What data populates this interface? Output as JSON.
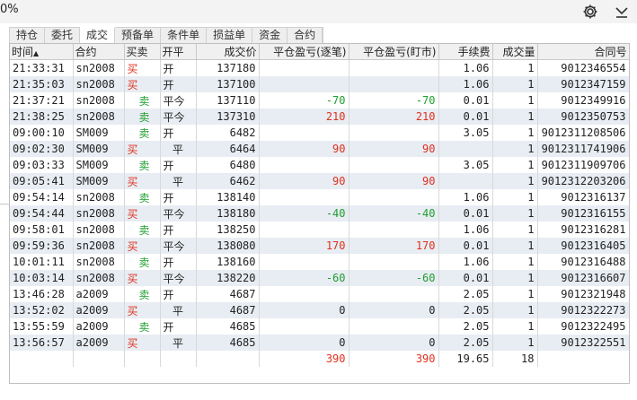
{
  "window": {
    "title": "0%"
  },
  "icons": {
    "settings": "gear-icon",
    "collapse": "chevron-down-icon"
  },
  "tabs": [
    {
      "label": "持仓",
      "active": false
    },
    {
      "label": "委托",
      "active": false
    },
    {
      "label": "成交",
      "active": true
    },
    {
      "label": "预备单",
      "active": false
    },
    {
      "label": "条件单",
      "active": false
    },
    {
      "label": "损益单",
      "active": false
    },
    {
      "label": "资金",
      "active": false
    },
    {
      "label": "合约",
      "active": false
    }
  ],
  "table": {
    "headers": {
      "time": "时间",
      "sort_mark": "▲",
      "code": "合约",
      "dir": "买卖",
      "oc": "开平",
      "price": "成交价",
      "pnl_trade": "平仓盈亏(逐笔)",
      "pnl_mark": "平仓盈亏(盯市)",
      "fee": "手续费",
      "qty": "成交量",
      "contract": "合同号"
    },
    "rows": [
      {
        "time": "21:33:31",
        "code": "sn2008",
        "dir": "买",
        "oc": "开",
        "price": "137180",
        "pnl_trade": "",
        "pnl_mark": "",
        "fee": "1.06",
        "qty": "1",
        "contract": "9012346554"
      },
      {
        "time": "21:35:03",
        "code": "sn2008",
        "dir": "买",
        "oc": "开",
        "price": "137100",
        "pnl_trade": "",
        "pnl_mark": "",
        "fee": "1.06",
        "qty": "1",
        "contract": "9012347159"
      },
      {
        "time": "21:37:21",
        "code": "sn2008",
        "dir": "卖",
        "oc": "平今",
        "price": "137110",
        "pnl_trade": "-70",
        "pnl_mark": "-70",
        "fee": "0.01",
        "qty": "1",
        "contract": "9012349916"
      },
      {
        "time": "21:38:25",
        "code": "sn2008",
        "dir": "卖",
        "oc": "平今",
        "price": "137310",
        "pnl_trade": "210",
        "pnl_mark": "210",
        "fee": "0.01",
        "qty": "1",
        "contract": "9012350753"
      },
      {
        "time": "09:00:10",
        "code": "SM009",
        "dir": "卖",
        "oc": "开",
        "price": "6482",
        "pnl_trade": "",
        "pnl_mark": "",
        "fee": "3.05",
        "qty": "1",
        "contract": "9012311208506"
      },
      {
        "time": "09:02:30",
        "code": "SM009",
        "dir": "买",
        "oc": "平",
        "price": "6464",
        "pnl_trade": "90",
        "pnl_mark": "90",
        "fee": "",
        "qty": "1",
        "contract": "9012311741906"
      },
      {
        "time": "09:03:33",
        "code": "SM009",
        "dir": "卖",
        "oc": "开",
        "price": "6480",
        "pnl_trade": "",
        "pnl_mark": "",
        "fee": "3.05",
        "qty": "1",
        "contract": "9012311909706"
      },
      {
        "time": "09:05:41",
        "code": "SM009",
        "dir": "买",
        "oc": "平",
        "price": "6462",
        "pnl_trade": "90",
        "pnl_mark": "90",
        "fee": "",
        "qty": "1",
        "contract": "9012312203206"
      },
      {
        "time": "09:54:14",
        "code": "sn2008",
        "dir": "卖",
        "oc": "开",
        "price": "138140",
        "pnl_trade": "",
        "pnl_mark": "",
        "fee": "1.06",
        "qty": "1",
        "contract": "9012316137"
      },
      {
        "time": "09:54:44",
        "code": "sn2008",
        "dir": "买",
        "oc": "平今",
        "price": "138180",
        "pnl_trade": "-40",
        "pnl_mark": "-40",
        "fee": "0.01",
        "qty": "1",
        "contract": "9012316155"
      },
      {
        "time": "09:58:01",
        "code": "sn2008",
        "dir": "卖",
        "oc": "开",
        "price": "138250",
        "pnl_trade": "",
        "pnl_mark": "",
        "fee": "1.06",
        "qty": "1",
        "contract": "9012316281"
      },
      {
        "time": "09:59:36",
        "code": "sn2008",
        "dir": "买",
        "oc": "平今",
        "price": "138080",
        "pnl_trade": "170",
        "pnl_mark": "170",
        "fee": "0.01",
        "qty": "1",
        "contract": "9012316405"
      },
      {
        "time": "10:01:11",
        "code": "sn2008",
        "dir": "卖",
        "oc": "开",
        "price": "138160",
        "pnl_trade": "",
        "pnl_mark": "",
        "fee": "1.06",
        "qty": "1",
        "contract": "9012316488"
      },
      {
        "time": "10:03:14",
        "code": "sn2008",
        "dir": "买",
        "oc": "平今",
        "price": "138220",
        "pnl_trade": "-60",
        "pnl_mark": "-60",
        "fee": "0.01",
        "qty": "1",
        "contract": "9012316607"
      },
      {
        "time": "13:46:28",
        "code": "a2009",
        "dir": "卖",
        "oc": "开",
        "price": "4687",
        "pnl_trade": "",
        "pnl_mark": "",
        "fee": "2.05",
        "qty": "1",
        "contract": "9012321948"
      },
      {
        "time": "13:52:02",
        "code": "a2009",
        "dir": "买",
        "oc": "平",
        "price": "4687",
        "pnl_trade": "0",
        "pnl_mark": "0",
        "fee": "2.05",
        "qty": "1",
        "contract": "9012322273"
      },
      {
        "time": "13:55:59",
        "code": "a2009",
        "dir": "卖",
        "oc": "开",
        "price": "4685",
        "pnl_trade": "",
        "pnl_mark": "",
        "fee": "2.05",
        "qty": "1",
        "contract": "9012322495"
      },
      {
        "time": "13:56:57",
        "code": "a2009",
        "dir": "买",
        "oc": "平",
        "price": "4685",
        "pnl_trade": "0",
        "pnl_mark": "0",
        "fee": "2.05",
        "qty": "1",
        "contract": "9012322551"
      }
    ],
    "summary": {
      "pnl_trade": "390",
      "pnl_mark": "390",
      "fee": "19.65",
      "qty": "18"
    }
  },
  "colors": {
    "buy": "#e0301e",
    "sell": "#1f9e2e",
    "loss": "#1f9e2e",
    "profit": "#e0301e",
    "row_alt": "#e8edf3"
  }
}
